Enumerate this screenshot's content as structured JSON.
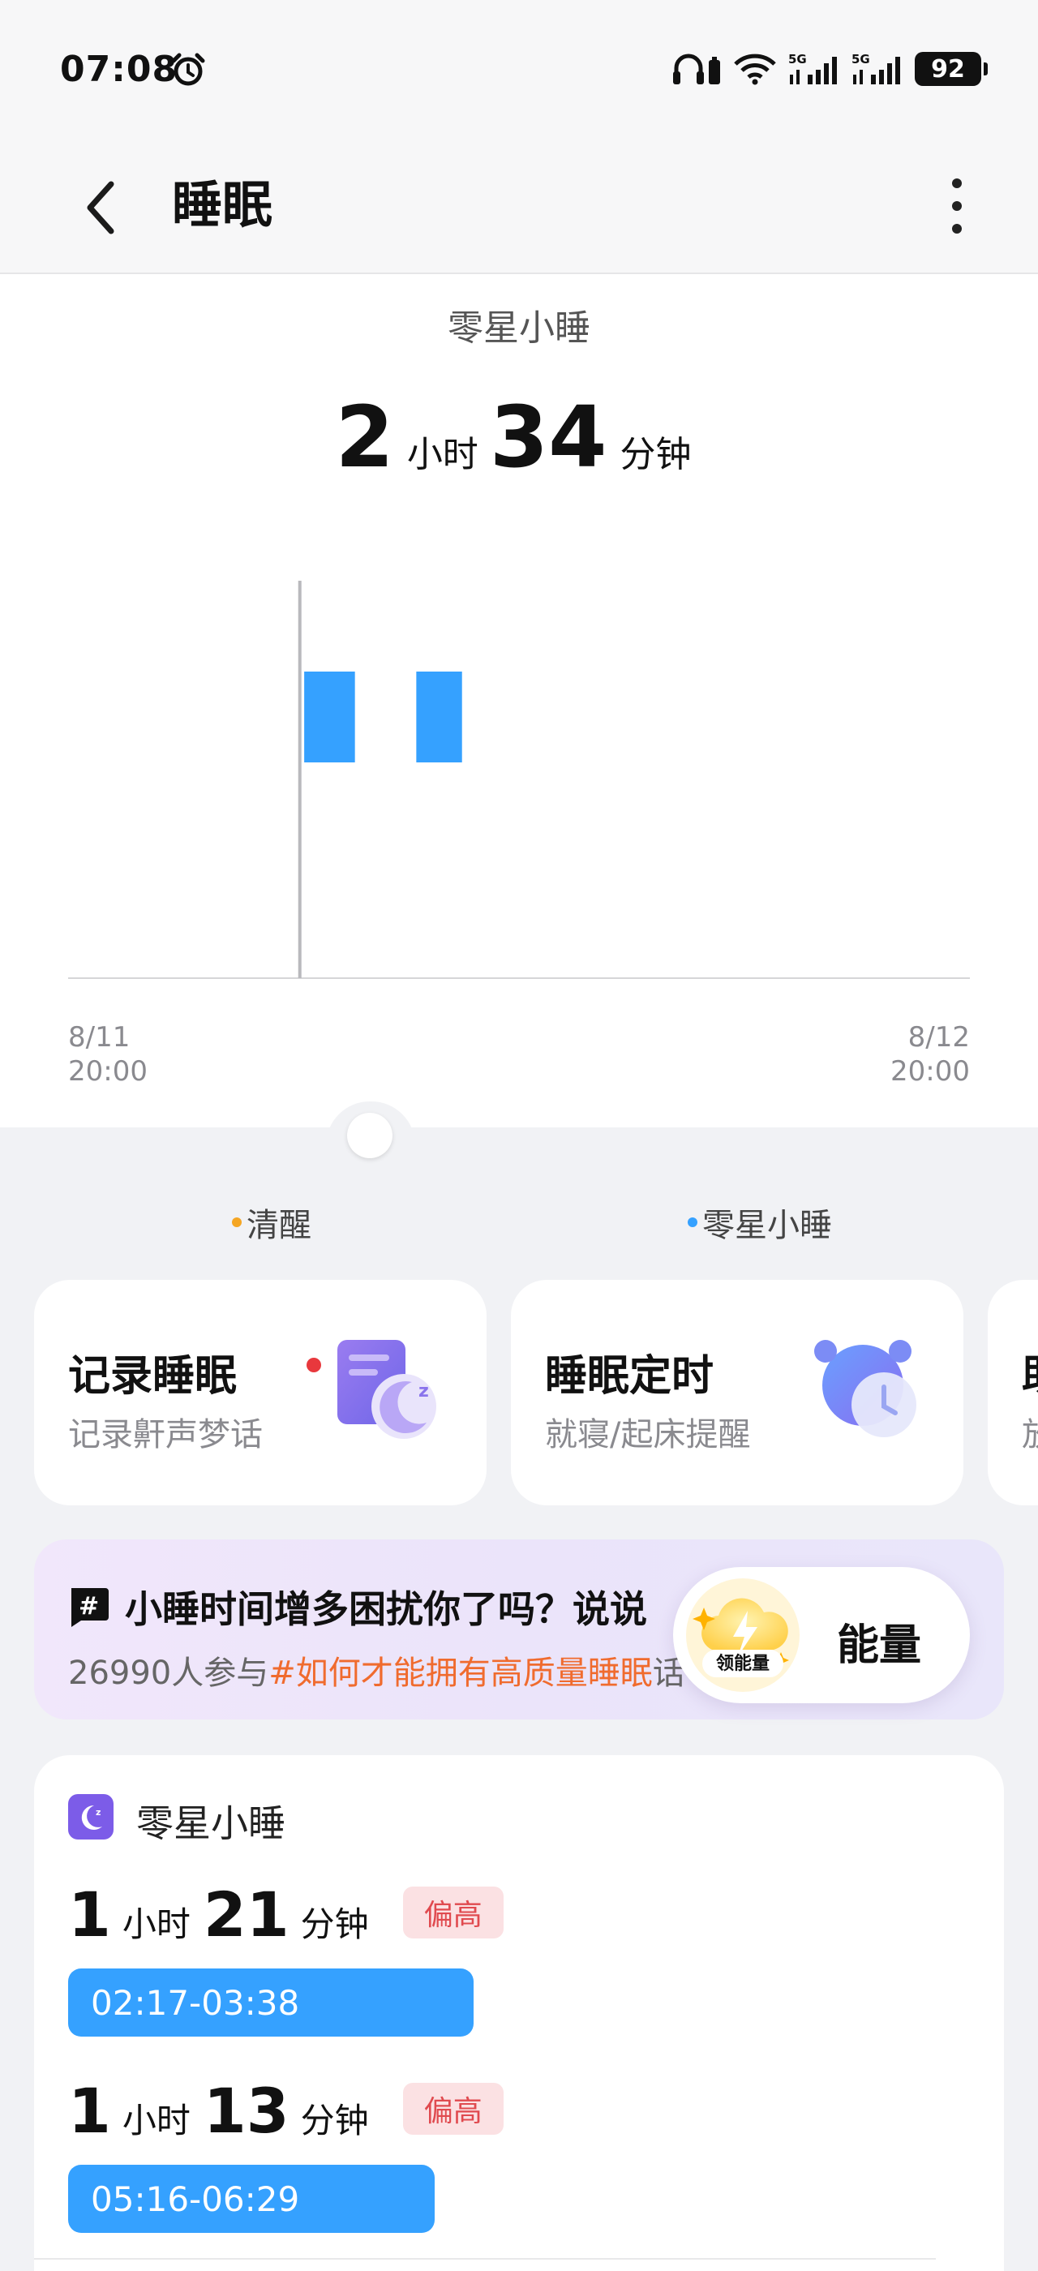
{
  "status_bar": {
    "time": "07:08",
    "battery": "92",
    "icons": [
      "alarm-icon",
      "headphones-icon",
      "wifi-icon",
      "signal-5g-icon",
      "signal-5g-icon",
      "battery-icon"
    ]
  },
  "header": {
    "title": "睡眠",
    "back_icon": "back-arrow-icon",
    "more_icon": "more-vertical-icon"
  },
  "summary": {
    "type_label": "零星小睡",
    "hours": "2",
    "hours_unit": "小时",
    "minutes": "34",
    "minutes_unit": "分钟"
  },
  "chart_data": {
    "type": "bar",
    "x_start_label": [
      "8/11",
      "20:00"
    ],
    "x_end_label": [
      "8/12",
      "20:00"
    ],
    "x_range": [
      "2024-08-11 20:00",
      "2024-08-12 20:00"
    ],
    "selected_time": "02:10",
    "bars": [
      {
        "start": "02:17",
        "end": "03:38",
        "stage": "零星小睡"
      },
      {
        "start": "05:16",
        "end": "06:29",
        "stage": "零星小睡"
      }
    ],
    "bar_color": "#35a1ff",
    "grid": false
  },
  "legend": [
    {
      "label": "清醒",
      "color": "#f5a623"
    },
    {
      "label": "零星小睡",
      "color": "#35a1ff"
    }
  ],
  "feature_cards": [
    {
      "title": "记录睡眠",
      "subtitle": "记录鼾声梦话",
      "icon": "sleep-record-icon",
      "has_red_dot": true
    },
    {
      "title": "睡眠定时",
      "subtitle": "就寝/起床提醒",
      "icon": "alarm-clock-icon"
    },
    {
      "title": "助",
      "subtitle": "放",
      "icon": "partial-card"
    }
  ],
  "topic": {
    "title": "小睡时间增多困扰你了吗？说说",
    "participants": "26990人参与",
    "hashtag": "#如何才能拥有高质量睡眠",
    "suffix": "话"
  },
  "energy": {
    "badge": "领能量",
    "label": "能量"
  },
  "nap_list": {
    "title": "零星小睡",
    "entries": [
      {
        "hours": "1",
        "hours_unit": "小时",
        "minutes": "21",
        "minutes_unit": "分钟",
        "badge": "偏高",
        "range": "02:17-03:38"
      },
      {
        "hours": "1",
        "hours_unit": "小时",
        "minutes": "13",
        "minutes_unit": "分钟",
        "badge": "偏高",
        "range": "05:16-06:29"
      }
    ]
  }
}
